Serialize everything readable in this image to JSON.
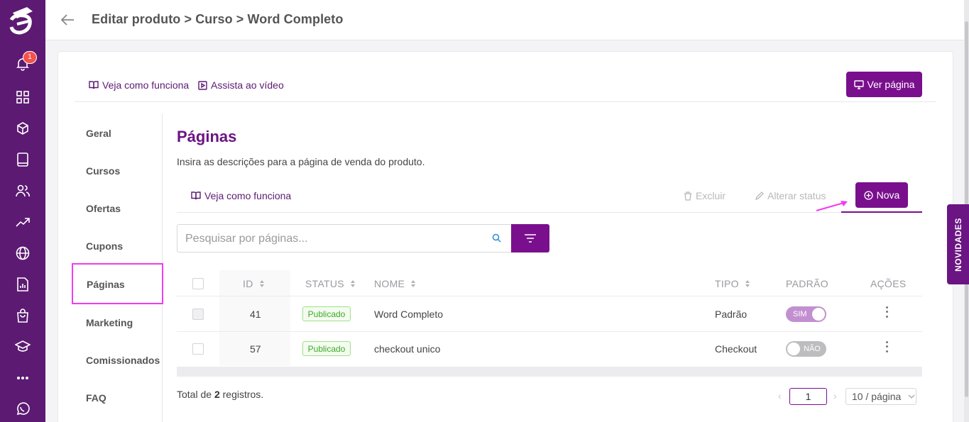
{
  "header": {
    "title": "Editar produto > Curso > Word Completo"
  },
  "notifications": {
    "count": "1"
  },
  "links": {
    "how_it_works": "Veja como funciona",
    "watch_video": "Assista ao vídeo"
  },
  "buttons": {
    "view_page": "Ver página",
    "new": "Nova",
    "delete": "Excluir",
    "change_status": "Alterar status"
  },
  "side_menu": {
    "items": [
      {
        "label": "Geral"
      },
      {
        "label": "Cursos"
      },
      {
        "label": "Ofertas"
      },
      {
        "label": "Cupons"
      },
      {
        "label": "Páginas"
      },
      {
        "label": "Marketing"
      },
      {
        "label": "Comissionados"
      },
      {
        "label": "FAQ"
      }
    ],
    "active": "Páginas"
  },
  "section": {
    "title": "Páginas",
    "description": "Insira as descrições para a página de venda do produto.",
    "toolbar_link": "Veja como funciona"
  },
  "search": {
    "placeholder": "Pesquisar por páginas..."
  },
  "table": {
    "columns": [
      "ID",
      "STATUS",
      "NOME",
      "TIPO",
      "PADRÃO",
      "AÇÕES"
    ],
    "rows": [
      {
        "id": "41",
        "status": "Publicado",
        "name": "Word Completo",
        "type": "Padrão",
        "default": "SIM"
      },
      {
        "id": "57",
        "status": "Publicado",
        "name": "checkout unico",
        "type": "Checkout",
        "default": "NÃO"
      }
    ]
  },
  "footer": {
    "total_prefix": "Total de",
    "total_count": "2",
    "total_suffix": "registros.",
    "page": "1",
    "page_size": "10 / página"
  },
  "news_tab": {
    "label": "NOVIDADES"
  },
  "colors": {
    "brand": "#5c1a73",
    "accent": "#7a0f8e",
    "highlight": "#f03cf0",
    "success": "#3fa82a"
  }
}
